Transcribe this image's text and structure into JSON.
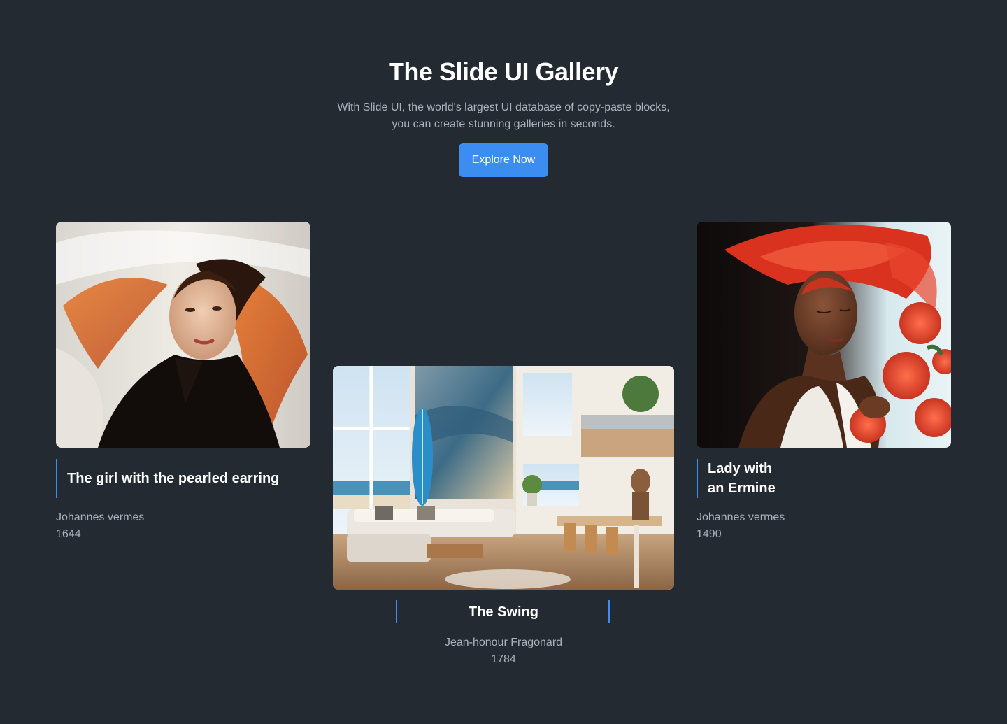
{
  "hero": {
    "title": "The Slide UI Gallery",
    "subtitle_line1": "With Slide UI, the world's largest UI database of copy-paste blocks,",
    "subtitle_line2": "you can create stunning galleries in seconds.",
    "cta_label": "Explore Now"
  },
  "colors": {
    "background": "#232a31",
    "accent": "#3b8df1",
    "text_primary": "#ffffff",
    "text_secondary": "#aab3bd"
  },
  "gallery": [
    {
      "title": "The girl with the pearled earring",
      "artist": "Johannes vermes",
      "year": "1644",
      "image": "portrait-woman-flowing-hair"
    },
    {
      "title": "The Swing",
      "artist": "Jean-honour Fragonard",
      "year": "1784",
      "image": "beach-house-living-room"
    },
    {
      "title_line1": "Lady with",
      "title_line2": "an Ermine",
      "artist": "Johannes vermes",
      "year": "1490",
      "image": "portrait-woman-red-hat-roses"
    }
  ]
}
